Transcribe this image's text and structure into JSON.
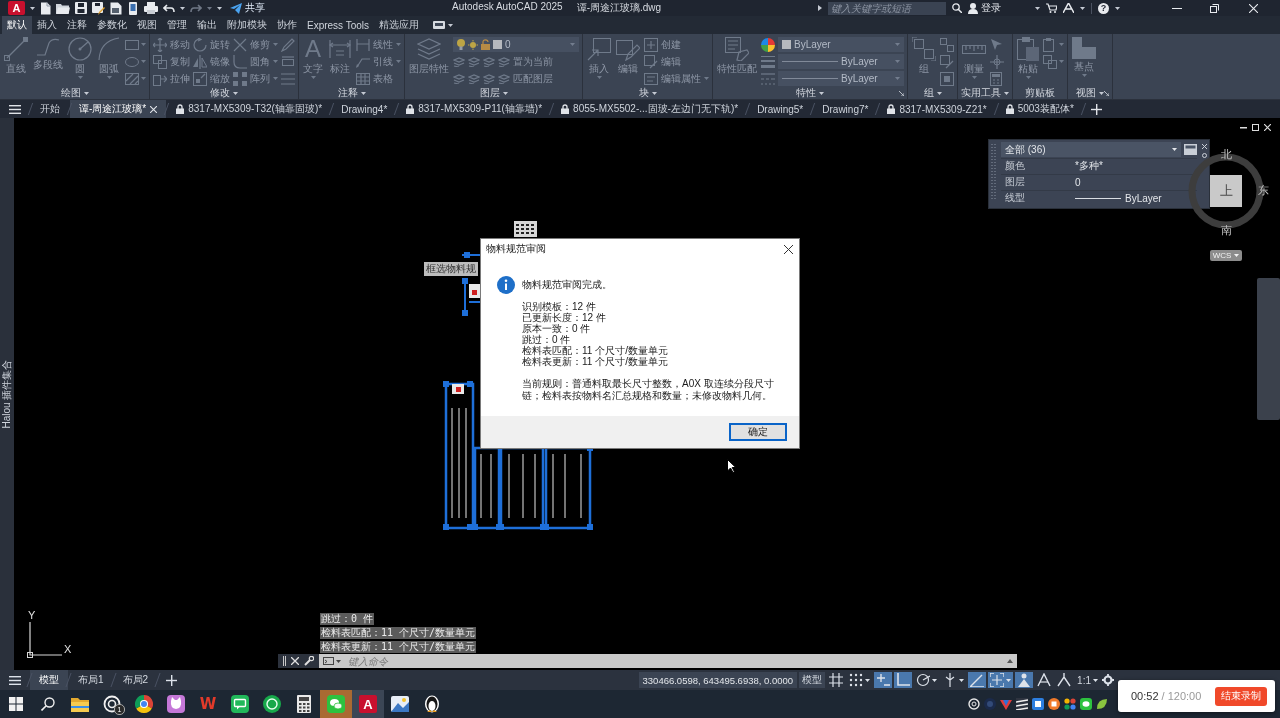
{
  "title_bar": {
    "logo": "A",
    "share": "共享",
    "app_title": "Autodesk AutoCAD 2025",
    "file_name": "谭-周途江玻璃.dwg",
    "search": {
      "placeholder": "键入关键字或短语"
    },
    "sign_in": "登录",
    "help": "?"
  },
  "ribbon_tabs": [
    {
      "label": "默认",
      "selected": true
    },
    {
      "label": "插入",
      "selected": false
    },
    {
      "label": "注释",
      "selected": false
    },
    {
      "label": "参数化",
      "selected": false
    },
    {
      "label": "视图",
      "selected": false
    },
    {
      "label": "管理",
      "selected": false
    },
    {
      "label": "输出",
      "selected": false
    },
    {
      "label": "附加模块",
      "selected": false
    },
    {
      "label": "协作",
      "selected": false
    },
    {
      "label": "Express Tools",
      "selected": false
    },
    {
      "label": "精选应用",
      "selected": false
    }
  ],
  "ribbon_panels": [
    {
      "title": "绘图",
      "dropdown": true,
      "launcher": false,
      "columns": [
        [
          {
            "kind": "large",
            "label": "直线",
            "dropdown": false,
            "disabled": true
          }
        ],
        [
          {
            "kind": "large",
            "label": "多段线",
            "dropdown": false,
            "disabled": true
          }
        ],
        [
          {
            "kind": "large",
            "label": "圆",
            "dropdown": true,
            "disabled": true
          }
        ],
        [
          {
            "kind": "large",
            "label": "圆弧",
            "dropdown": true,
            "disabled": true
          }
        ],
        [
          {
            "kind": "mini",
            "dropdown": true,
            "disabled": true
          },
          {
            "kind": "mini",
            "dropdown": true,
            "disabled": true
          },
          {
            "kind": "mini",
            "dropdown": true,
            "disabled": true
          }
        ]
      ]
    },
    {
      "title": "修改",
      "dropdown": true,
      "launcher": false,
      "columns": [
        [
          {
            "kind": "small",
            "label": "移动",
            "dropdown": false,
            "disabled": true
          },
          {
            "kind": "small",
            "label": "复制",
            "dropdown": false,
            "disabled": true
          },
          {
            "kind": "small",
            "label": "拉伸",
            "dropdown": false,
            "disabled": true
          }
        ],
        [
          {
            "kind": "small",
            "label": "旋转",
            "dropdown": false,
            "disabled": true
          },
          {
            "kind": "small",
            "label": "镜像",
            "dropdown": false,
            "disabled": true
          },
          {
            "kind": "small",
            "label": "缩放",
            "dropdown": false,
            "disabled": true
          }
        ],
        [
          {
            "kind": "small",
            "label": "修剪",
            "dropdown": true,
            "disabled": true
          },
          {
            "kind": "small",
            "label": "圆角",
            "dropdown": true,
            "disabled": true
          },
          {
            "kind": "small",
            "label": "阵列",
            "dropdown": true,
            "disabled": true
          }
        ],
        [
          {
            "kind": "mini",
            "dropdown": false,
            "disabled": true
          },
          {
            "kind": "mini",
            "dropdown": false,
            "disabled": true
          },
          {
            "kind": "mini",
            "dropdown": false,
            "disabled": true
          }
        ]
      ]
    },
    {
      "title": "注释",
      "dropdown": true,
      "launcher": false,
      "columns": [
        [
          {
            "kind": "large",
            "glyph": "A",
            "label": "文字",
            "dropdown": true,
            "disabled": true
          }
        ],
        [
          {
            "kind": "large",
            "label": "标注",
            "dropdown": false,
            "disabled": true
          }
        ],
        [
          {
            "kind": "small",
            "label": "线性",
            "dropdown": true,
            "disabled": true
          },
          {
            "kind": "small",
            "label": "引线",
            "dropdown": true,
            "disabled": true
          },
          {
            "kind": "small",
            "label": "表格",
            "dropdown": false,
            "disabled": true
          }
        ]
      ]
    },
    {
      "title": "图层",
      "dropdown": true,
      "launcher": false,
      "columns": [
        [
          {
            "kind": "large",
            "label": "图层特性",
            "dropdown": false,
            "disabled": true
          }
        ],
        [
          {
            "kind": "combo",
            "value": "0",
            "dropdown": true,
            "disabled": true
          },
          {
            "kind": "small",
            "label": "置为当前",
            "dropdown": false,
            "disabled": true
          },
          {
            "kind": "small",
            "label": "匹配图层",
            "dropdown": false,
            "disabled": true
          }
        ]
      ]
    },
    {
      "title": "块",
      "dropdown": true,
      "launcher": false,
      "columns": [
        [
          {
            "kind": "large",
            "label": "插入",
            "dropdown": true,
            "disabled": true
          }
        ],
        [
          {
            "kind": "large",
            "label": "编辑",
            "dropdown": false,
            "disabled": true
          }
        ],
        [
          {
            "kind": "small",
            "label": "创建",
            "dropdown": false,
            "disabled": true
          },
          {
            "kind": "small",
            "label": "编辑",
            "dropdown": false,
            "disabled": true
          },
          {
            "kind": "small",
            "label": "编辑属性",
            "dropdown": true,
            "disabled": true
          }
        ]
      ]
    },
    {
      "title": "特性",
      "dropdown": true,
      "launcher": true,
      "columns": [
        [
          {
            "kind": "large",
            "label": "特性匹配",
            "dropdown": false,
            "disabled": true
          }
        ],
        [
          {
            "kind": "mini",
            "dropdown": false,
            "disabled": false
          },
          {
            "kind": "mini",
            "dropdown": false,
            "disabled": true
          },
          {
            "kind": "mini",
            "dropdown": false,
            "disabled": true
          }
        ],
        [
          {
            "kind": "combo",
            "value": "ByLayer",
            "dropdown": true,
            "disabled": true
          },
          {
            "kind": "combo",
            "value": "ByLayer",
            "dropdown": true,
            "disabled": true
          },
          {
            "kind": "combo",
            "value": "ByLayer",
            "dropdown": true,
            "disabled": true
          }
        ]
      ]
    },
    {
      "title": "组",
      "dropdown": true,
      "launcher": false,
      "columns": [
        [
          {
            "kind": "large",
            "label": "组",
            "dropdown": false,
            "disabled": true
          }
        ],
        [
          {
            "kind": "mini",
            "dropdown": false,
            "disabled": true
          },
          {
            "kind": "mini",
            "dropdown": false,
            "disabled": true
          },
          {
            "kind": "mini",
            "dropdown": false,
            "disabled": true
          }
        ]
      ]
    },
    {
      "title": "实用工具",
      "dropdown": true,
      "launcher": false,
      "columns": [
        [
          {
            "kind": "large",
            "label": "测量",
            "dropdown": true,
            "disabled": true
          }
        ],
        [
          {
            "kind": "mini",
            "dropdown": false,
            "disabled": true
          },
          {
            "kind": "mini",
            "dropdown": false,
            "disabled": true
          },
          {
            "kind": "mini",
            "dropdown": false,
            "disabled": true
          }
        ]
      ]
    },
    {
      "title": "剪贴板",
      "dropdown": false,
      "launcher": false,
      "columns": [
        [
          {
            "kind": "large",
            "label": "粘贴",
            "dropdown": true,
            "disabled": true
          }
        ],
        [
          {
            "kind": "mini",
            "dropdown": true,
            "disabled": true
          },
          {
            "kind": "mini",
            "dropdown": true,
            "disabled": true
          }
        ]
      ]
    },
    {
      "title": "视图",
      "dropdown": true,
      "launcher": true,
      "columns": [
        [
          {
            "kind": "large",
            "label": "基点",
            "dropdown": true,
            "disabled": true
          }
        ]
      ]
    }
  ],
  "file_tabs": [
    {
      "label": "开始",
      "selected": false,
      "locked": false
    },
    {
      "label": "谭-周途江玻璃*",
      "selected": true,
      "locked": false
    },
    {
      "label": "8317-MX5309-T32(轴靠固玻)*",
      "selected": false,
      "locked": true
    },
    {
      "label": "Drawing4*",
      "selected": false,
      "locked": false
    },
    {
      "label": "8317-MX5309-P11(轴靠墙)*",
      "selected": false,
      "locked": true
    },
    {
      "label": "8055-MX5502-...固玻-左边门无下轨)*",
      "selected": false,
      "locked": true
    },
    {
      "label": "Drawing5*",
      "selected": false,
      "locked": false
    },
    {
      "label": "Drawing7*",
      "selected": false,
      "locked": false
    },
    {
      "label": "8317-MX5309-Z21*",
      "selected": false,
      "locked": true
    },
    {
      "label": "5003装配体*",
      "selected": false,
      "locked": true
    }
  ],
  "canvas": {
    "side_label": "Halou 插件集合",
    "tooltip": "框选物料规",
    "quick_properties": {
      "filter": "全部 (36)",
      "rows": [
        {
          "kind": "text",
          "name": "颜色",
          "value": "*多种*"
        },
        {
          "kind": "text",
          "name": "图层",
          "value": "0"
        },
        {
          "kind": "linetype",
          "name": "线型",
          "value": "ByLayer"
        }
      ]
    },
    "viewcube": {
      "north": "北",
      "east": "东",
      "south": "南",
      "face": "上",
      "ucs": "WCS"
    },
    "ucs_icon": {
      "x": "X",
      "y": "Y"
    },
    "command_history": [
      "跳过：0 件",
      "检料表匹配：11 个尺寸/数量单元",
      "检料表更新：11 个尺寸/数量单元"
    ],
    "command_line": {
      "placeholder": "键入命令"
    }
  },
  "dialog": {
    "title": "物料规范审阅",
    "heading": "物料规范审阅完成。",
    "lines": [
      "识别模板：12 件",
      "已更新长度：12 件",
      "原本一致：0 件",
      "跳过：0 件",
      "检料表匹配：11 个尺寸/数量单元",
      "检料表更新：11 个尺寸/数量单元"
    ],
    "rule": "当前规则：普通料取最长尺寸整数，A0X 取连续分段尺寸链；检料表按物料名汇总规格和数量；未修改物料几何。",
    "ok_button": "确定"
  },
  "status_bar": {
    "layout_tabs": [
      {
        "label": "模型",
        "selected": true
      },
      {
        "label": "布局1",
        "selected": false
      },
      {
        "label": "布局2",
        "selected": false
      }
    ],
    "coordinates": "330466.0598, 643495.6938, 0.0000",
    "space": "模型",
    "toggles": [
      {
        "on": false,
        "dropdown": false
      },
      {
        "on": false,
        "dropdown": true
      },
      {
        "on": true,
        "dropdown": false
      },
      {
        "on": true,
        "dropdown": false
      },
      {
        "on": false,
        "dropdown": true
      },
      {
        "on": false,
        "dropdown": true
      },
      {
        "on": true,
        "dropdown": false
      },
      {
        "on": true,
        "dropdown": true
      },
      {
        "on": true,
        "dropdown": false
      },
      {
        "on": false,
        "dropdown": false
      },
      {
        "on": false,
        "dropdown": false
      }
    ],
    "scale": "1:1"
  },
  "taskbar": {
    "apps": [
      {
        "active": false,
        "attention": false
      },
      {
        "active": false,
        "attention": false,
        "badge": "1"
      },
      {
        "active": false,
        "attention": false
      },
      {
        "active": false,
        "attention": false
      },
      {
        "active": false,
        "attention": false,
        "glyph": "W"
      },
      {
        "active": false,
        "attention": false
      },
      {
        "active": false,
        "attention": false
      },
      {
        "active": false,
        "attention": false
      },
      {
        "active": false,
        "attention": true
      },
      {
        "active": true,
        "attention": false,
        "glyph": "A"
      },
      {
        "active": false,
        "attention": false
      },
      {
        "active": false,
        "attention": false
      }
    ]
  },
  "recorder": {
    "elapsed": "00:52",
    "limit": "/ 120:00",
    "stop_button": "结束录制"
  }
}
